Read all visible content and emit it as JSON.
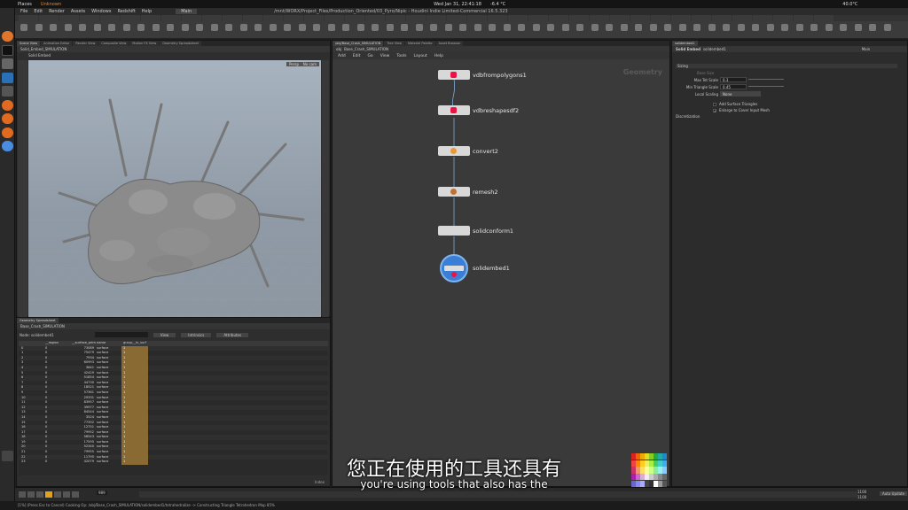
{
  "system": {
    "places": "Places",
    "app": "Unknown",
    "datetime": "Wed Jan 31, 22:41:18",
    "temp": "-6.4 °C",
    "cpu_temp": "40.0°C"
  },
  "window_title": "/mnt/WORX/Project_Files/Production_Oriented/03_Pyro/Nipic - Houdini Indie Limited-Commercial 16.5.323",
  "menus": [
    "File",
    "Edit",
    "Render",
    "Assets",
    "Windows",
    "Redshift",
    "Help"
  ],
  "desktop": "Main",
  "viewport": {
    "tabs": [
      "Scene View",
      "Animation Editor",
      "Render View",
      "Composite View",
      "Motion FX View",
      "Geometry Spreadsheet"
    ],
    "path": "Solid_Embed_SIMULATION",
    "node": "Solid Embed",
    "cam_buttons": [
      "Persp",
      "No cam"
    ]
  },
  "spreadsheet": {
    "tab": "Geometry Spreadsheet",
    "path": "Base_Crash_SIMULATION",
    "node_label": "Node: solidembed1",
    "view": "View",
    "intrinsics": "Intrinsics",
    "attributes": "Attributes",
    "headers": [
      "",
      "__region",
      "__surface_prim",
      "name",
      "group__in_surf"
    ],
    "rows": [
      [
        "0",
        "0",
        "73089",
        "surface",
        "1"
      ],
      [
        "1",
        "0",
        "75479",
        "surface",
        "1"
      ],
      [
        "2",
        "0",
        "7934",
        "surface",
        "1"
      ],
      [
        "3",
        "0",
        "60993",
        "surface",
        "1"
      ],
      [
        "4",
        "0",
        "3641",
        "surface",
        "1"
      ],
      [
        "5",
        "0",
        "42429",
        "surface",
        "1"
      ],
      [
        "6",
        "0",
        "51854",
        "surface",
        "1"
      ],
      [
        "7",
        "0",
        "44730",
        "surface",
        "1"
      ],
      [
        "8",
        "0",
        "18521",
        "surface",
        "1"
      ],
      [
        "9",
        "0",
        "57361",
        "surface",
        "1"
      ],
      [
        "10",
        "0",
        "29331",
        "surface",
        "1"
      ],
      [
        "11",
        "0",
        "83957",
        "surface",
        "1"
      ],
      [
        "12",
        "0",
        "39977",
        "surface",
        "1"
      ],
      [
        "13",
        "0",
        "84544",
        "surface",
        "1"
      ],
      [
        "14",
        "0",
        "3524",
        "surface",
        "1"
      ],
      [
        "15",
        "0",
        "77392",
        "surface",
        "1"
      ],
      [
        "16",
        "0",
        "12751",
        "surface",
        "1"
      ],
      [
        "17",
        "0",
        "79952",
        "surface",
        "1"
      ],
      [
        "18",
        "0",
        "58543",
        "surface",
        "1"
      ],
      [
        "19",
        "0",
        "17595",
        "surface",
        "1"
      ],
      [
        "20",
        "0",
        "52340",
        "surface",
        "1"
      ],
      [
        "21",
        "0",
        "79955",
        "surface",
        "1"
      ],
      [
        "22",
        "0",
        "11795",
        "surface",
        "1"
      ],
      [
        "23",
        "0",
        "42079",
        "surface",
        "1"
      ]
    ],
    "index_label": "Index"
  },
  "network": {
    "tabs": [
      "/obj/Base_Crash_SIMULATION",
      "Tree View",
      "Material Palette",
      "Asset Browser"
    ],
    "path": "obj",
    "node": "Base_Crash_SIMULATION",
    "menu": [
      "Add",
      "Edit",
      "Go",
      "View",
      "Tools",
      "Layout",
      "Help"
    ],
    "context_label": "Geometry",
    "nodes": [
      "vdbfrompolygons1",
      "vdbreshapesdf2",
      "convert2",
      "remesh2",
      "solidconform1",
      "solidembed1"
    ]
  },
  "params": {
    "tab": "solidembed1",
    "node_type": "Solid Embed",
    "node_name": "solidembed1",
    "search": "Main",
    "section": "Sizing",
    "base_size": "Base Size",
    "max_tet_scale_label": "Max Tet Scale",
    "max_tet_scale": "0.3",
    "min_triangle_scale_label": "Min Triangle Scale",
    "min_triangle_scale": "0.45",
    "local_scaling_label": "Local Scaling",
    "local_scaling": "None",
    "add_surface_triangles": "Add Surface Triangles",
    "enlarge": "Enlarge to Cover Input Mesh",
    "discretization": "Discretization"
  },
  "timeline": {
    "frame": "989",
    "start": "1",
    "end": "1100",
    "end2": "1100",
    "auto_update": "Auto Update"
  },
  "status_text": "[1%] (Press Esc to Cancel) Cooking Op: /obj/Base_Crash_SIMULATION/solidembed1/tetrahedralize -> Constructing Triangle Tetrahedron Map 85%",
  "subtitle_cn": "您正在使用的工具还具有",
  "subtitle_en": "you're using tools that also has the",
  "colors": {
    "node_selected": "#3a7fd5",
    "spread_highlight": "#8a6a33",
    "accent": "#e0a020"
  }
}
